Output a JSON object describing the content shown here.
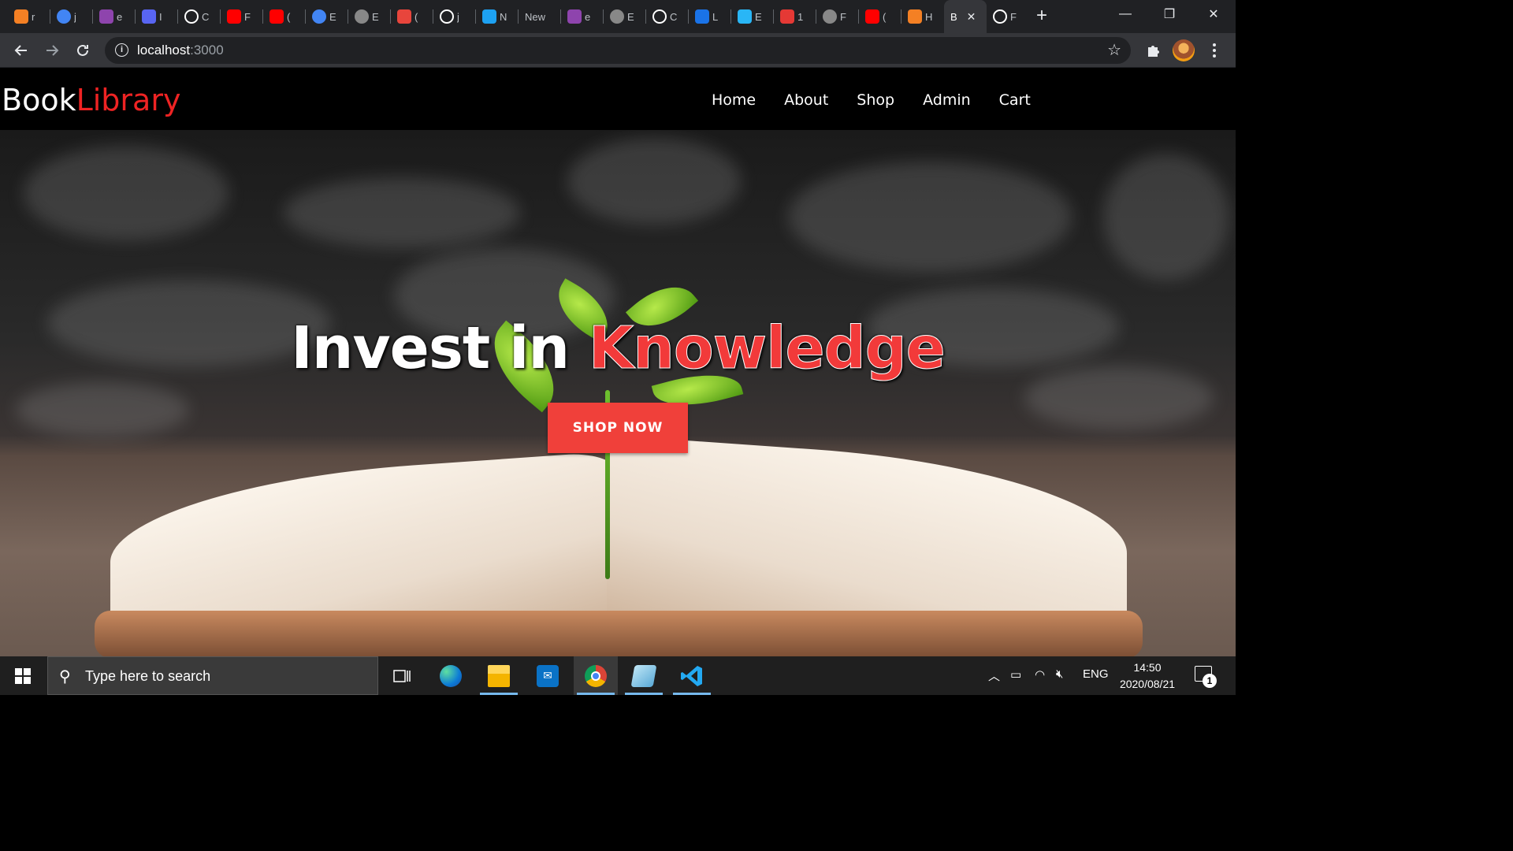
{
  "browser": {
    "tabs": [
      {
        "icon": "stackoverflow-icon",
        "color": "#f48024",
        "title": "r"
      },
      {
        "icon": "google-icon",
        "color": "#4285f4",
        "title": "j"
      },
      {
        "icon": "hackerrank-icon",
        "color": "#8e44ad",
        "title": "e"
      },
      {
        "icon": "discord-icon",
        "color": "#5865f2",
        "title": "I"
      },
      {
        "icon": "github-icon",
        "color": "#ffffff",
        "title": "C"
      },
      {
        "icon": "youtube-icon",
        "color": "#ff0000",
        "title": "F"
      },
      {
        "icon": "youtube-icon",
        "color": "#ff0000",
        "title": "("
      },
      {
        "icon": "google-icon",
        "color": "#4285f4",
        "title": "E"
      },
      {
        "icon": "globe-icon",
        "color": "#888888",
        "title": "E"
      },
      {
        "icon": "app-icon",
        "color": "#e8453c",
        "title": "("
      },
      {
        "icon": "github-icon",
        "color": "#ffffff",
        "title": "j"
      },
      {
        "icon": "twitter-icon",
        "color": "#1da1f2",
        "title": "N"
      },
      {
        "icon": "none",
        "color": "#202124",
        "title": "New"
      },
      {
        "icon": "hackerrank-icon",
        "color": "#8e44ad",
        "title": "e"
      },
      {
        "icon": "globe-icon",
        "color": "#888888",
        "title": "E"
      },
      {
        "icon": "github-icon",
        "color": "#ffffff",
        "title": "C"
      },
      {
        "icon": "refresh-app-icon",
        "color": "#1a73e8",
        "title": "L"
      },
      {
        "icon": "app-icon",
        "color": "#29b6f6",
        "title": "E"
      },
      {
        "icon": "codeforces-icon",
        "color": "#e53935",
        "title": "1"
      },
      {
        "icon": "globe-icon",
        "color": "#888888",
        "title": "F"
      },
      {
        "icon": "youtube-icon",
        "color": "#ff0000",
        "title": "("
      },
      {
        "icon": "stackoverflow-icon",
        "color": "#f48024",
        "title": "H"
      },
      {
        "icon": "none",
        "color": "#35363a",
        "title": "B",
        "active": true
      },
      {
        "icon": "github-icon",
        "color": "#ffffff",
        "title": "F"
      }
    ],
    "new_tab_label": "+",
    "url_host": "localhost",
    "url_port": ":3000",
    "info_glyph": "i",
    "star_glyph": "☆",
    "controls": {
      "minimize": "—",
      "restore": "❐",
      "close": "✕"
    }
  },
  "site": {
    "brand_part1": "Book",
    "brand_part2": "Library",
    "nav": [
      "Home",
      "About",
      "Shop",
      "Admin",
      "Cart"
    ],
    "headline_part1": "Invest in ",
    "headline_part2": "Knowledge",
    "cta": "SHOP NOW"
  },
  "taskbar": {
    "search_placeholder": "Type here to search",
    "language": "ENG",
    "time": "14:50",
    "date": "2020/08/21",
    "notifications": "1",
    "apps": [
      {
        "name": "task-view-icon",
        "running": false
      },
      {
        "name": "edge-icon",
        "running": false
      },
      {
        "name": "file-explorer-icon",
        "running": true
      },
      {
        "name": "mail-icon",
        "running": false
      },
      {
        "name": "chrome-icon",
        "running": true,
        "active": true
      },
      {
        "name": "notepad-icon",
        "running": true
      },
      {
        "name": "vscode-icon",
        "running": true
      }
    ]
  },
  "colors": {
    "brand_red": "#ee2323",
    "cta_red": "#f0403a",
    "chrome_dark": "#202124"
  }
}
